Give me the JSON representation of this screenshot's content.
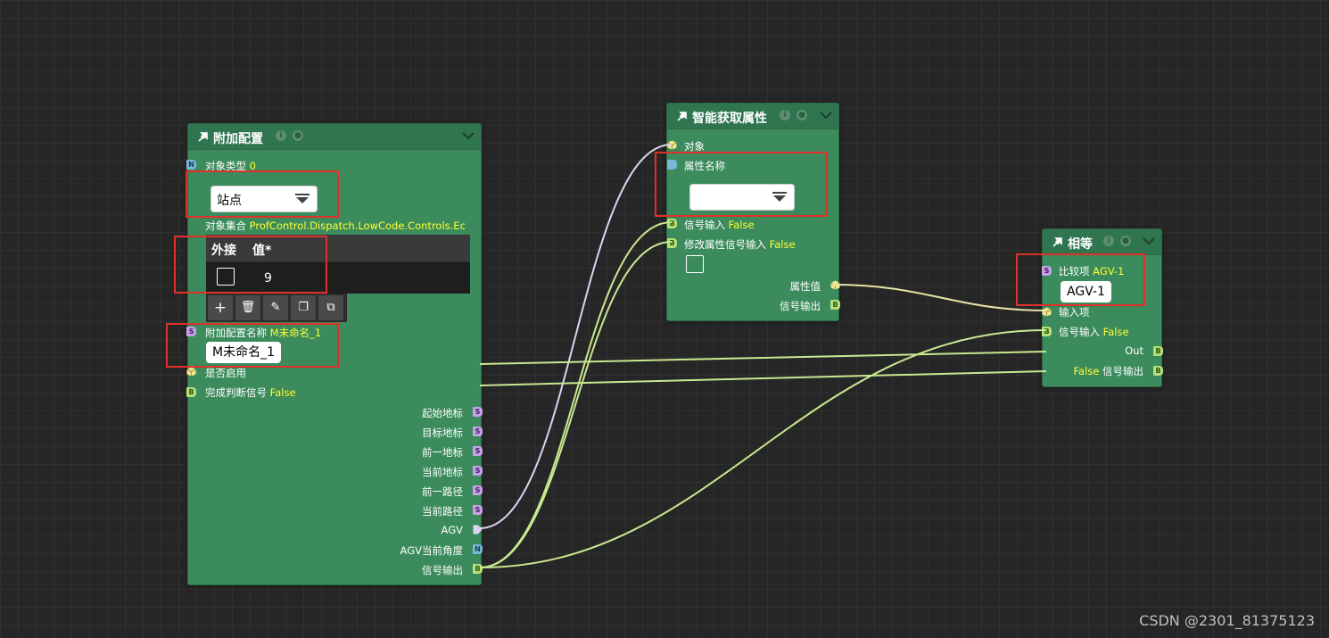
{
  "node_attach": {
    "title": "附加配置",
    "obj_type_label": "对象类型",
    "obj_type_value": "0",
    "obj_type_dropdown": "站点",
    "collection_label": "对象集合",
    "collection_value": "ProfControl.Dispatch.LowCode.Controls.Ec",
    "grid_headers": [
      "外接",
      "值*"
    ],
    "grid_row_value": "9",
    "toolbar_icons": [
      "add-icon",
      "delete-icon",
      "clear-icon",
      "copy-icon",
      "duplicate-icon"
    ],
    "config_name_label": "附加配置名称",
    "config_name_value": "M未命名_1",
    "config_name_input": "M未命名_1",
    "enabled_label": "是否启用",
    "done_label": "完成判断信号",
    "done_value": "False",
    "outputs": [
      "起始地标",
      "目标地标",
      "前一地标",
      "当前地标",
      "前一路径",
      "当前路径",
      "AGV",
      "AGV当前角度",
      "信号输出"
    ]
  },
  "node_smart": {
    "title": "智能获取属性",
    "object_label": "对象",
    "prop_name_label": "属性名称",
    "prop_dropdown": "",
    "signal_in_label": "信号输入",
    "signal_in_value": "False",
    "modify_label": "修改属性信号输入",
    "modify_value": "False",
    "prop_value_label": "属性值",
    "signal_out_label": "信号输出"
  },
  "node_equal": {
    "title": "相等",
    "compare_label": "比较项",
    "compare_value": "AGV-1",
    "compare_input": "AGV-1",
    "input_label": "输入项",
    "signal_in_label": "信号输入",
    "signal_in_value": "False",
    "out_label": "Out",
    "signal_out_value": "False",
    "signal_out_label": "信号输出"
  },
  "pin_letters": {
    "string": "S",
    "bool": "B",
    "number": "N"
  },
  "colors": {
    "node_body": "#3b8b5c",
    "node_header": "#2f7550",
    "value_text": "#ffff33",
    "highlight": "#e0302a",
    "wire_bool": "#c8e890",
    "wire_object": "#e8e4a8",
    "wire_agv": "#dcd4f0"
  },
  "watermark": "CSDN @2301_81375123"
}
